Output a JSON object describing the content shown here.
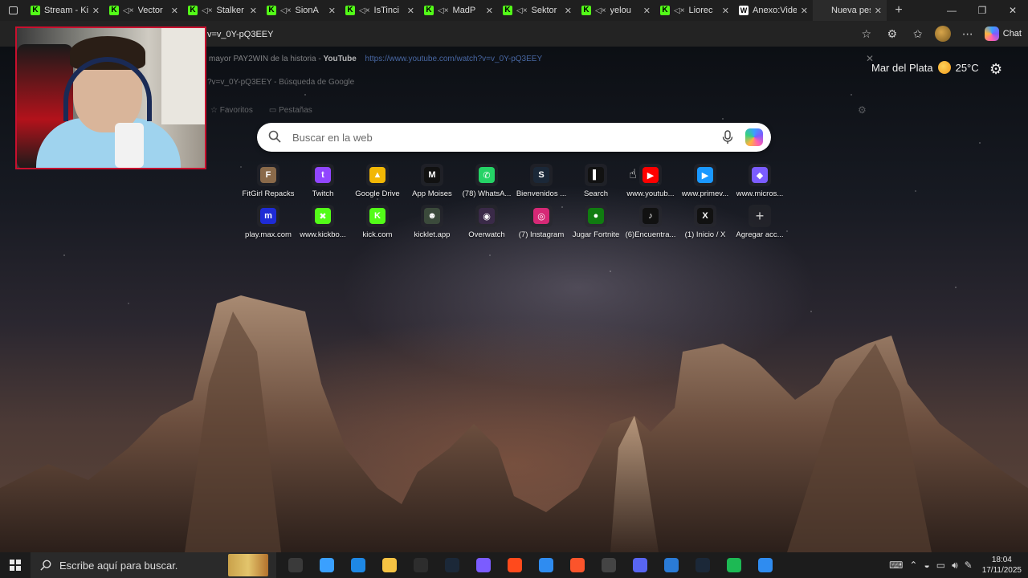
{
  "tabs": [
    {
      "title": "Stream - Ki",
      "icon": "kick",
      "muted": false
    },
    {
      "title": "Vector",
      "icon": "kick",
      "muted": true
    },
    {
      "title": "Stalker",
      "icon": "kick",
      "muted": true
    },
    {
      "title": "SionA",
      "icon": "kick",
      "muted": true
    },
    {
      "title": "IsTinci",
      "icon": "kick",
      "muted": true
    },
    {
      "title": "MadP",
      "icon": "kick",
      "muted": true
    },
    {
      "title": "Sektor",
      "icon": "kick",
      "muted": true
    },
    {
      "title": "yelou",
      "icon": "kick",
      "muted": true
    },
    {
      "title": "Liorec",
      "icon": "kick",
      "muted": true
    },
    {
      "title": "Anexo:Vide",
      "icon": "wikipedia",
      "muted": false
    },
    {
      "title": "Nueva pest",
      "icon": "edge",
      "muted": false,
      "active": true
    }
  ],
  "address": {
    "url": "v=v_0Y-pQ3EEY"
  },
  "suggestions": {
    "line1_title": "mayor PAY2WIN de la historia",
    "line1_site": "YouTube",
    "line1_link": "https://www.youtube.com/watch?v=v_0Y-pQ3EEY",
    "line2": "?v=v_0Y-pQ3EEY - Búsqueda de Google",
    "fav_label": "Favoritos",
    "tabs_label": "Pestañas"
  },
  "weather": {
    "city": "Mar del Plata",
    "temp": "25°C"
  },
  "search": {
    "placeholder": "Buscar en la web"
  },
  "addr_right": {
    "chat_label": "Chat"
  },
  "quick_links": [
    {
      "label": "FitGirl Repacks",
      "color": "#8a6a4a",
      "glyph": "F"
    },
    {
      "label": "Twitch",
      "color": "#9146ff",
      "glyph": "t"
    },
    {
      "label": "Google Drive",
      "color": "#f2b705",
      "glyph": "▲"
    },
    {
      "label": "App Moises",
      "color": "#111111",
      "glyph": "M"
    },
    {
      "label": "(78) WhatsA...",
      "color": "#25d366",
      "glyph": "✆"
    },
    {
      "label": "Bienvenidos ...",
      "color": "#1b2838",
      "glyph": "S"
    },
    {
      "label": "Search",
      "color": "#111111",
      "glyph": "▌"
    },
    {
      "label": "www.youtub...",
      "color": "#ff0000",
      "glyph": "▶"
    },
    {
      "label": "www.primev...",
      "color": "#1a98ff",
      "glyph": "▶"
    },
    {
      "label": "www.micros...",
      "color": "#7b5cff",
      "glyph": "◆"
    },
    {
      "label": "play.max.com",
      "color": "#1e2bd6",
      "glyph": "m"
    },
    {
      "label": "www.kickbo...",
      "color": "#53fc18",
      "glyph": "✖"
    },
    {
      "label": "kick.com",
      "color": "#53fc18",
      "glyph": "K"
    },
    {
      "label": "kicklet.app",
      "color": "#3b4a3b",
      "glyph": "☻"
    },
    {
      "label": "Overwatch",
      "color": "#3a2a48",
      "glyph": "◉"
    },
    {
      "label": "(7) Instagram",
      "color": "#d62976",
      "glyph": "◎"
    },
    {
      "label": "Jugar Fortnite",
      "color": "#107c10",
      "glyph": "●"
    },
    {
      "label": "(6)Encuentra...",
      "color": "#111111",
      "glyph": "♪"
    },
    {
      "label": "(1) Inicio / X",
      "color": "#111111",
      "glyph": "X"
    },
    {
      "label": "Agregar acc...",
      "color": "transparent",
      "glyph": "+"
    }
  ],
  "taskbar": {
    "search_placeholder": "Escribe aquí para buscar.",
    "apps": [
      "#3a3a3a",
      "#3aa0ff",
      "#1e88e5",
      "#f6c343",
      "#2d2d2d",
      "#1b2838",
      "#7b5cff",
      "#ff4a1c",
      "#2f8cf0",
      "#fb542b",
      "#444444",
      "#5865f2",
      "#2a7bd6",
      "#1b2838",
      "#1db954",
      "#2f8cf0"
    ],
    "time": "18:04",
    "date": "17/11/2025"
  },
  "colors": {
    "kick_green": "#53fc18",
    "webcam_border": "#c8102e"
  }
}
